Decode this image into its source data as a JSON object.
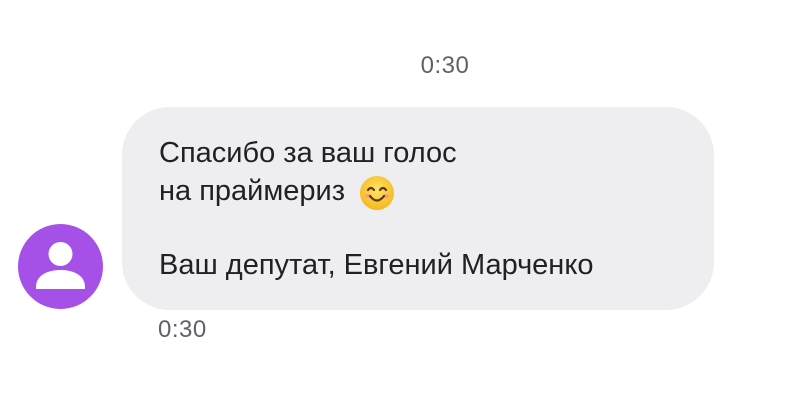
{
  "conversation": {
    "timestamp_top": "0:30",
    "timestamp_bottom": "0:30"
  },
  "message": {
    "line1": "Спасибо за ваш голос",
    "line2": "на праймериз",
    "line3": "Ваш депутат, Евгений Марченко",
    "emoji": "smiling-face-icon"
  },
  "avatar": {
    "icon": "person-icon",
    "color": "#a551e8"
  },
  "colors": {
    "bubble_background": "#eeeef0",
    "timestamp_text": "#5f6368",
    "message_text": "#202124"
  }
}
